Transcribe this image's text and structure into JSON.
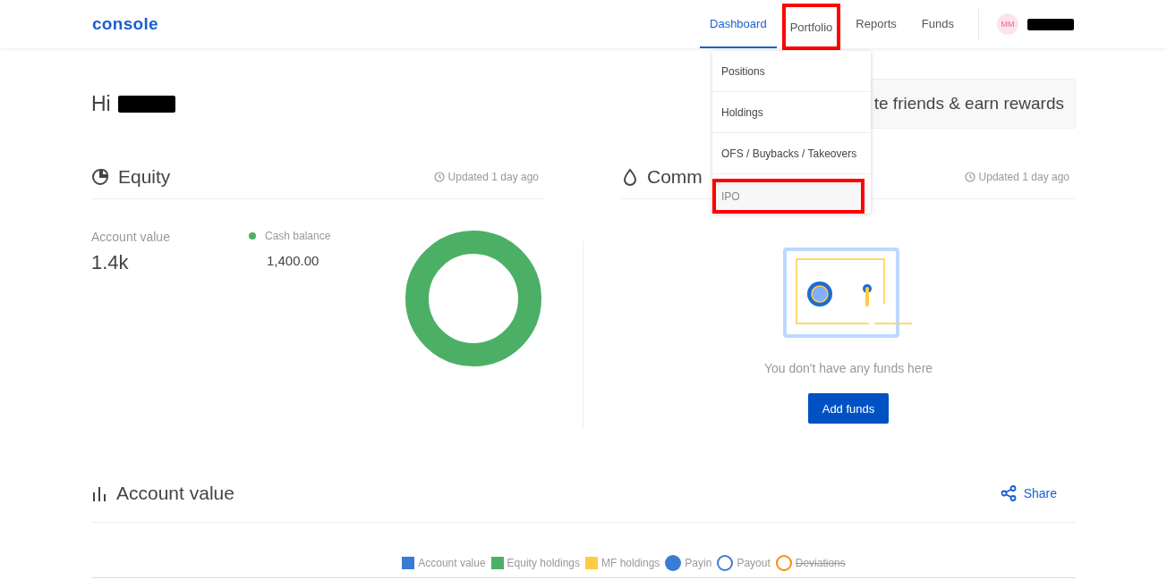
{
  "header": {
    "logo": "console",
    "nav": [
      {
        "label": "Dashboard",
        "selected": true,
        "highlighted": false
      },
      {
        "label": "Portfolio",
        "selected": false,
        "highlighted": true
      },
      {
        "label": "Reports",
        "selected": false,
        "highlighted": false
      },
      {
        "label": "Funds",
        "selected": false,
        "highlighted": false
      }
    ],
    "avatar": "MM"
  },
  "dropdown": {
    "items": [
      {
        "label": "Positions",
        "highlighted": false
      },
      {
        "label": "Holdings",
        "highlighted": false
      },
      {
        "label": "OFS / Buybacks / Takeovers",
        "highlighted": false
      },
      {
        "label": "IPO",
        "highlighted": true
      }
    ]
  },
  "greeting": "Hi",
  "banner": "te friends & earn rewards",
  "equity": {
    "title": "Equity",
    "updated": "Updated 1 day ago",
    "account_label": "Account value",
    "account_value": "1.4k",
    "legend": [
      {
        "label": "Cash balance",
        "value": "1,400.00",
        "color": "#4caf66"
      }
    ]
  },
  "commodity": {
    "title": "Comm",
    "updated": "Updated 1 day ago",
    "empty_text": "You don't have any funds here",
    "button": "Add funds"
  },
  "account_value": {
    "title": "Account value",
    "share": "Share",
    "legend": [
      {
        "label": "Account value",
        "kind": "square",
        "color": "#3a7bd5",
        "disabled": false
      },
      {
        "label": "Equity holdings",
        "kind": "square",
        "color": "#4caf66",
        "disabled": false
      },
      {
        "label": "MF holdings",
        "kind": "square",
        "color": "#ffcb45",
        "disabled": false
      },
      {
        "label": "Payin",
        "kind": "dot",
        "color": "#3a7bd5",
        "disabled": false
      },
      {
        "label": "Payout",
        "kind": "ring",
        "color": "#3a7bd5",
        "disabled": false
      },
      {
        "label": "Deviations",
        "kind": "ring",
        "color": "#ff8a00",
        "disabled": true
      }
    ]
  }
}
